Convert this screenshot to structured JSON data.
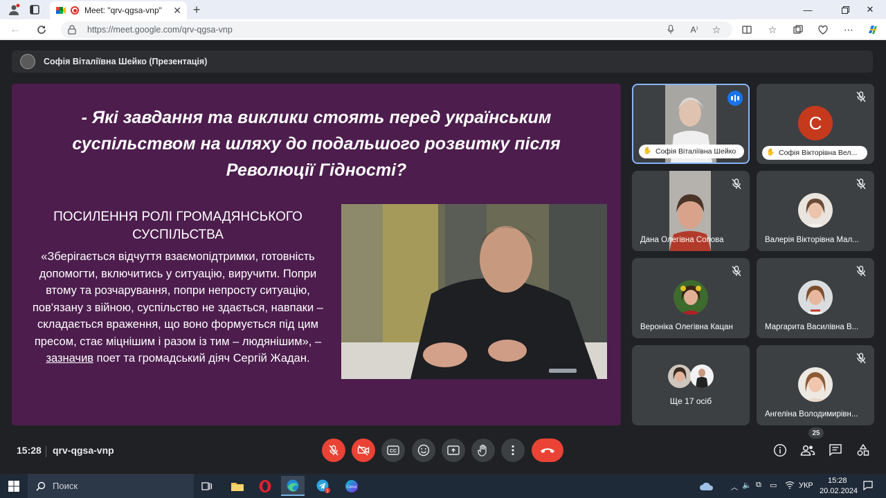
{
  "browser": {
    "tab_title": "Meet: \"qrv-qgsa-vnp\"",
    "url": "https://meet.google.com/qrv-qgsa-vnp",
    "url_proto": "https://",
    "url_host": "meet.google.com",
    "url_path": "/qrv-qgsa-vnp"
  },
  "presentation": {
    "banner": "Софія Віталіївна Шейко (Презентація)",
    "title": "- Які завдання та виклики стоять перед українським суспільством на шляху до подальшого розвитку після Революції Гідності?",
    "subtitle_line1": "ПОСИЛЕННЯ РОЛІ ГРОМАДЯНСЬКОГО",
    "subtitle_line2": "СУСПІЛЬСТВА",
    "quote_before": "«Зберігається відчуття взаємопідтримки, готовність допомогти, включитись у ситуацію, виручити. Попри втому та розчарування, попри непросту ситуацію, пов'язану з війною, суспільство не здається, навпаки – складається враження, що воно формується під цим пресом, стає міцнішим і разом із тим – людянішим», – ",
    "quote_link": "зазначив",
    "quote_after": " поет та громадський діяч Сергій Жадан."
  },
  "participants": [
    {
      "name": "Софія Віталіївна Шейко",
      "speaking": true
    },
    {
      "name": "Софія Вікторівна Вел...",
      "avatar_letter": "С"
    },
    {
      "name": "Дана Олегівна Сопова"
    },
    {
      "name": "Валерія Вікторівна Мал..."
    },
    {
      "name": "Вероніка Олегівна Кацан"
    },
    {
      "name": "Маргарита Василівна В..."
    },
    {
      "name": "Ще 17 осіб"
    },
    {
      "name": "Ангеліна Володимирівн..."
    }
  ],
  "bottom_bar": {
    "time": "15:28",
    "meeting_code": "qrv-qgsa-vnp",
    "participant_count": "25"
  },
  "taskbar": {
    "search_placeholder": "Поиск",
    "lang": "УКР",
    "time": "15:28",
    "date": "20.02.2024"
  },
  "colors": {
    "slide_bg": "#4c1d4d",
    "meet_bg": "#202124",
    "tile_bg": "#3c4043",
    "danger": "#ea4335",
    "accent": "#8ab4f8"
  }
}
